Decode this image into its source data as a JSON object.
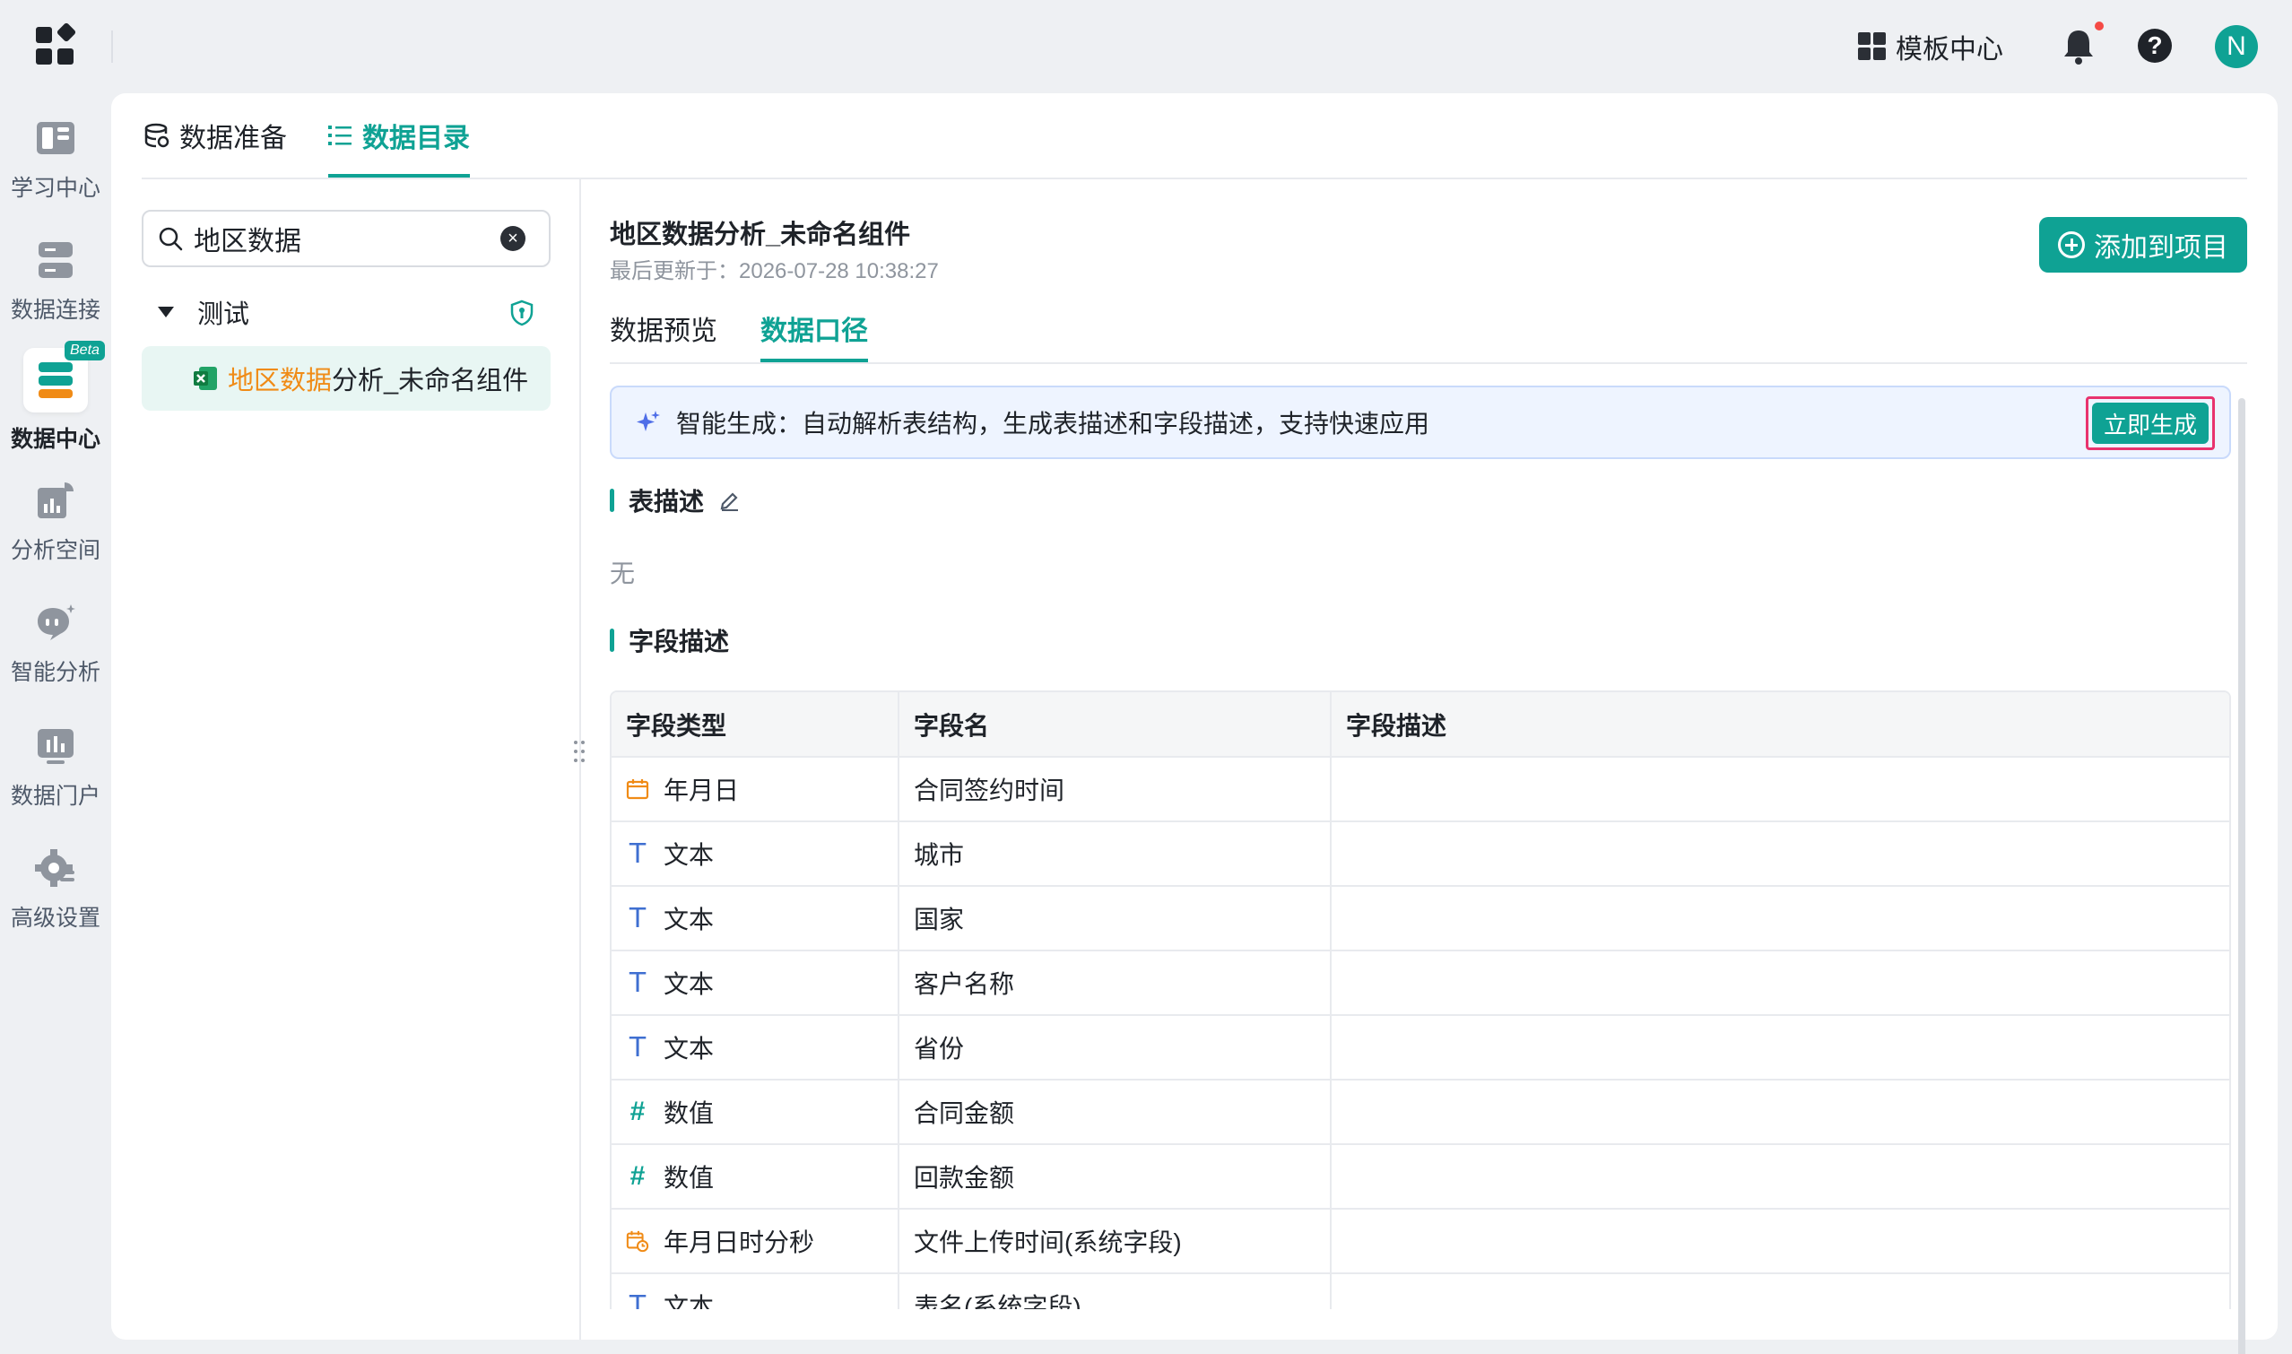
{
  "topbar": {
    "template_center_label": "模板中心",
    "avatar_initial": "N"
  },
  "nav": {
    "items": [
      {
        "label": "学习中心"
      },
      {
        "label": "数据连接"
      },
      {
        "label": "数据中心",
        "badge": "Beta"
      },
      {
        "label": "分析空间"
      },
      {
        "label": "智能分析"
      },
      {
        "label": "数据门户"
      },
      {
        "label": "高级设置"
      }
    ]
  },
  "tabs": {
    "prepare_label": "数据准备",
    "catalog_label": "数据目录"
  },
  "search": {
    "value": "地区数据"
  },
  "tree": {
    "folder_label": "测试",
    "file_highlight": "地区数据",
    "file_rest": "分析_未命名组件"
  },
  "dataset": {
    "title": "地区数据分析_未命名组件",
    "updated": "最后更新于：2026-07-28 10:38:27",
    "add_button_label": "添加到项目"
  },
  "subtabs": {
    "preview_label": "数据预览",
    "definition_label": "数据口径"
  },
  "ai_bar": {
    "text": "智能生成：自动解析表结构，生成表描述和字段描述，支持快速应用",
    "button_label": "立即生成"
  },
  "table_desc": {
    "title": "表描述",
    "value": "无"
  },
  "field_desc": {
    "title": "字段描述",
    "columns": [
      "字段类型",
      "字段名",
      "字段描述"
    ],
    "rows": [
      {
        "type": "年月日",
        "type_icon": "date",
        "name": "合同签约时间",
        "desc": ""
      },
      {
        "type": "文本",
        "type_icon": "text",
        "name": "城市",
        "desc": ""
      },
      {
        "type": "文本",
        "type_icon": "text",
        "name": "国家",
        "desc": ""
      },
      {
        "type": "文本",
        "type_icon": "text",
        "name": "客户名称",
        "desc": ""
      },
      {
        "type": "文本",
        "type_icon": "text",
        "name": "省份",
        "desc": ""
      },
      {
        "type": "数值",
        "type_icon": "number",
        "name": "合同金额",
        "desc": ""
      },
      {
        "type": "数值",
        "type_icon": "number",
        "name": "回款金额",
        "desc": ""
      },
      {
        "type": "年月日时分秒",
        "type_icon": "datetime",
        "name": "文件上传时间(系统字段)",
        "desc": ""
      },
      {
        "type": "文本",
        "type_icon": "text",
        "name": "表名(系统字段)",
        "desc": ""
      }
    ]
  },
  "colors": {
    "accent": "#0fa294",
    "highlight": "#f08b16",
    "focus_frame": "#e8336e"
  }
}
